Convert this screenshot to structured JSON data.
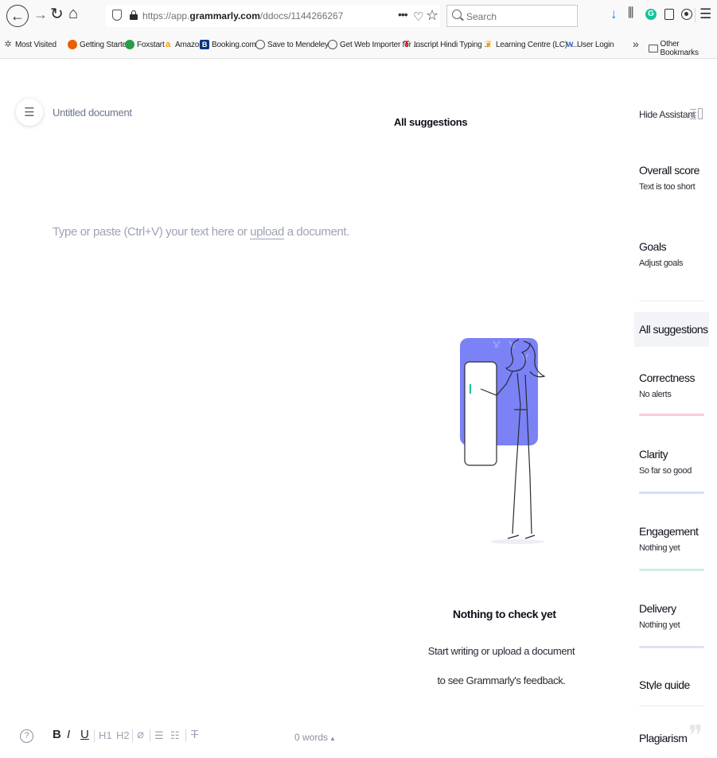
{
  "browser": {
    "url_prefix": "https://app.",
    "url_domain": "grammarly.com",
    "url_path": "/ddocs/1144266267",
    "search_placeholder": "Search",
    "bookmarks": [
      {
        "label": "Most Visited",
        "color": "#555555",
        "icon": "gear-icon"
      },
      {
        "label": "Getting Started",
        "color": "#e66000",
        "icon": "firefox-icon"
      },
      {
        "label": "Foxstart",
        "color": "#2b9d48",
        "icon": "foxstart-icon"
      },
      {
        "label": "Amazon",
        "color": "#ff9900",
        "icon": "amazon-icon"
      },
      {
        "label": "Booking.com",
        "color": "#003580",
        "icon": "booking-icon"
      },
      {
        "label": "Save to Mendeley",
        "color": "#555555",
        "icon": "globe-icon"
      },
      {
        "label": "Get Web Importer for ...",
        "color": "#555555",
        "icon": "globe-icon"
      },
      {
        "label": "Inscript Hindi Typing ...",
        "color": "#d00000",
        "icon": "inscript-icon"
      },
      {
        "label": "Learning Centre (LC) -...",
        "color": "#e8a400",
        "icon": "learning-icon"
      },
      {
        "label": "User Login",
        "color": "#3b6fd8",
        "icon": "w-icon"
      }
    ],
    "overflow_glyph": "»",
    "other_bookmarks": "Other Bookmarks"
  },
  "header": {
    "doc_title": "Untitled document",
    "panel_title": "All suggestions"
  },
  "editor": {
    "placeholder_before": "Type or paste (Ctrl+V) your text here or ",
    "upload_link": "upload",
    "placeholder_after": " a document."
  },
  "empty_state": {
    "title": "Nothing to check yet",
    "line1": "Start writing or upload a document",
    "line2": "to see Grammarly's feedback."
  },
  "format_bar": {
    "help": "?",
    "bold": "B",
    "italic": "I",
    "underline": "U",
    "h1": "H1",
    "h2": "H2",
    "link": "⌀",
    "ordered_list": "☰",
    "bullet_list": "☷",
    "clear": "T",
    "word_count": "0 words",
    "word_count_caret": "▲"
  },
  "sidebar": {
    "hide_assistant": "Hide Assistant",
    "overall_score": {
      "label": "Overall score",
      "sub": "Text is too short"
    },
    "goals": {
      "label": "Goals",
      "sub": "Adjust goals"
    },
    "all_suggestions": "All suggestions",
    "categories": [
      {
        "label": "Correctness",
        "sub": "No alerts",
        "color": "#f7cdd8"
      },
      {
        "label": "Clarity",
        "sub": "So far so good",
        "color": "#cfe0fb"
      },
      {
        "label": "Engagement",
        "sub": "Nothing yet",
        "color": "#cdeee4"
      },
      {
        "label": "Delivery",
        "sub": "Nothing yet",
        "color": "#e8dcf7"
      }
    ],
    "style_guide": "Style guide",
    "plagiarism": "Plagiarism"
  },
  "colors": {
    "accent_illustration": "#7b82f5",
    "grammarly_green": "#15c39a"
  }
}
